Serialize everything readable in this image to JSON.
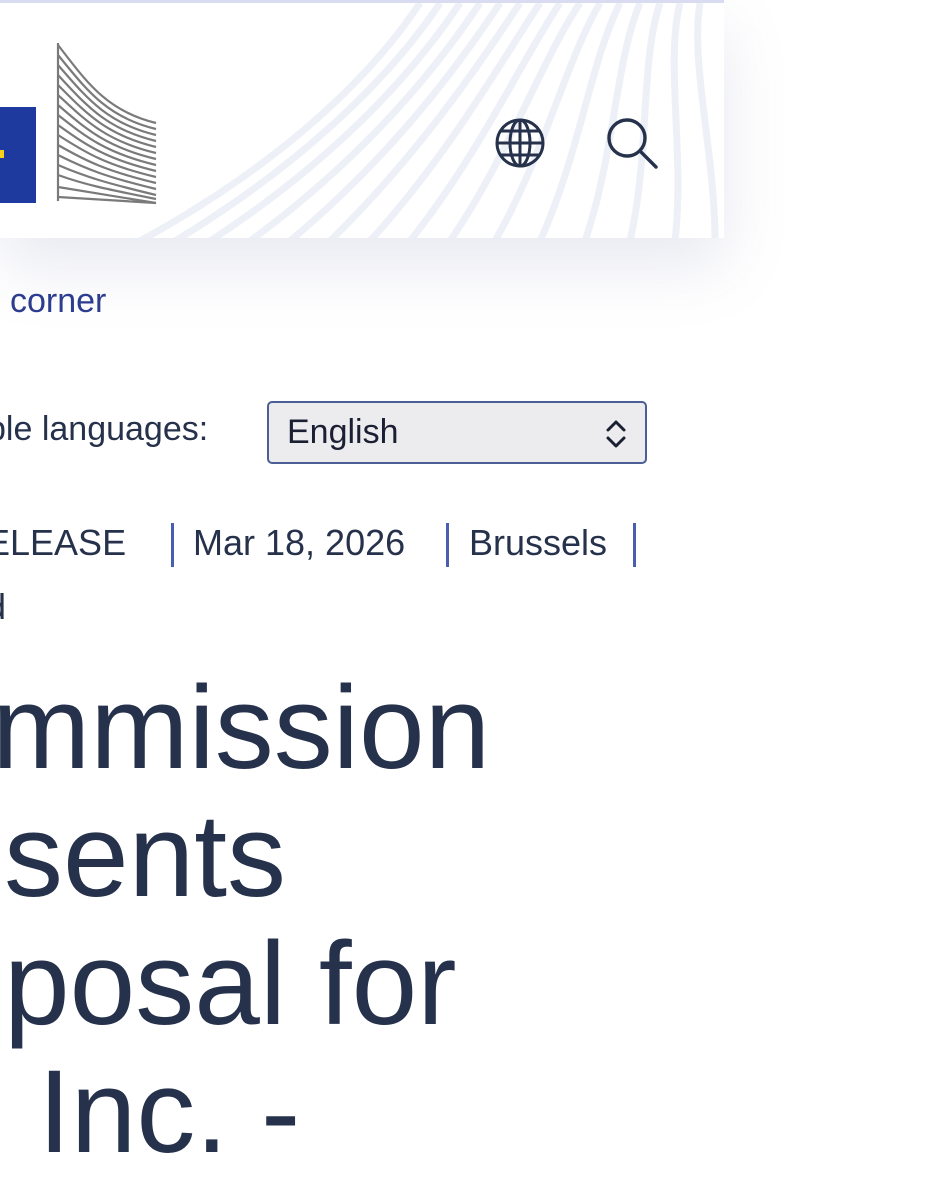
{
  "header": {
    "globe_icon": "globe-icon",
    "search_icon": "search-icon",
    "colors": {
      "flag": "#1f3a9e",
      "star": "#f7d117",
      "building": "#7a7a7a"
    }
  },
  "breadcrumb": {
    "link_text": "corner"
  },
  "language": {
    "label": "ble languages:",
    "selected": "English",
    "icon": "chevron-up-down-icon"
  },
  "meta": {
    "type": "ELEASE",
    "date": "Mar 18, 2026",
    "location": "Brussels",
    "second_line": "d"
  },
  "headline": {
    "lines": [
      "mmission",
      "sents",
      "posal for",
      "Inc. -"
    ]
  }
}
